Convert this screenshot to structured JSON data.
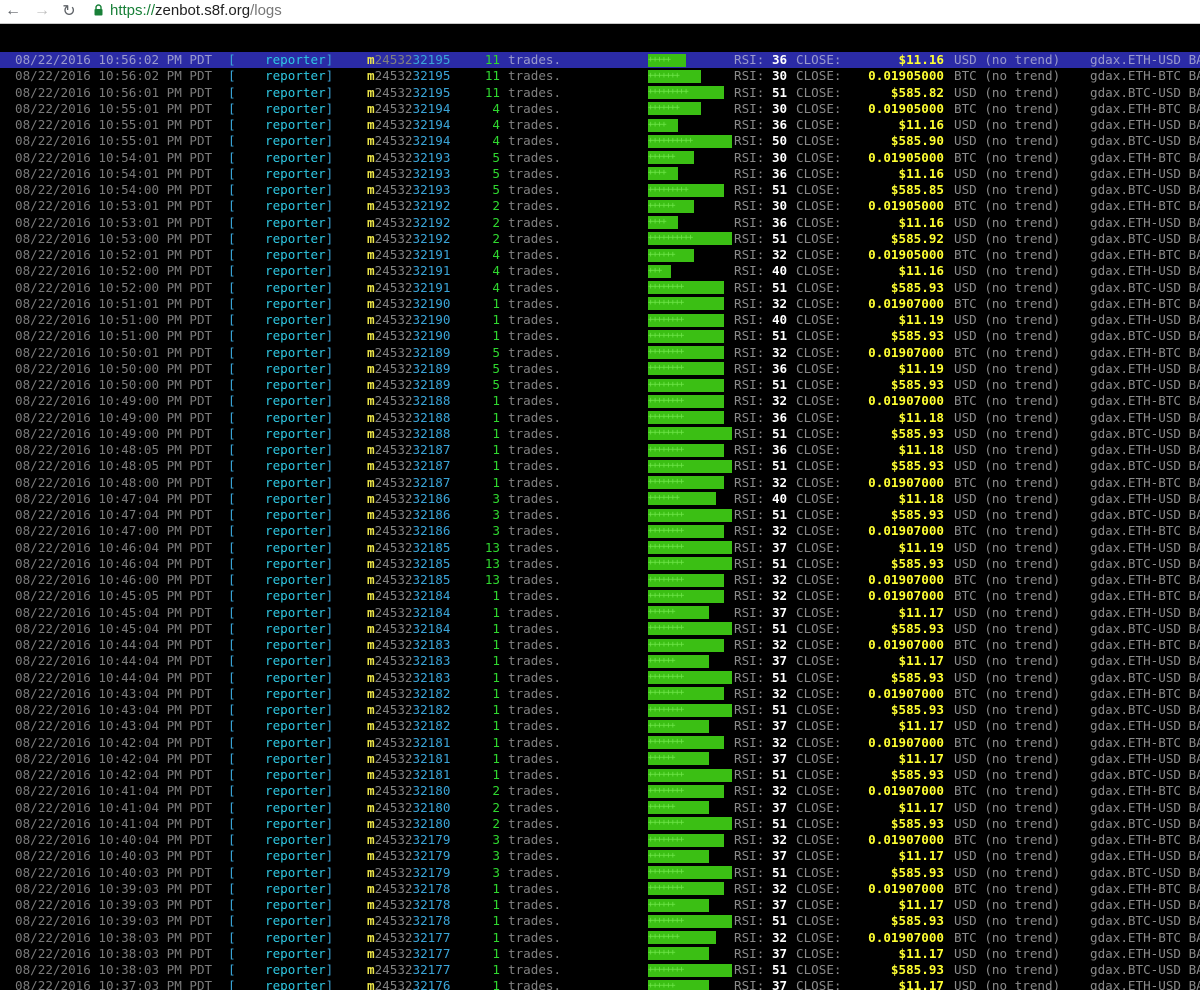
{
  "browser": {
    "url_scheme": "https://",
    "url_host": "zenbot.s8f.org",
    "url_path": "/logs",
    "back_icon": "arrow-left-icon",
    "forward_icon": "arrow-right-icon",
    "reload_icon": "reload-icon",
    "lock_icon": "lock-icon"
  },
  "colors": {
    "bar": "#3bbf14",
    "highlight": "#2b2ba6",
    "price": "#ffff32"
  },
  "log_columns": {
    "reporter": "reporter",
    "trades_suffix": "trades.",
    "rsi_label": "RSI:",
    "close_label": "CLOSE:",
    "bracket_open": "[",
    "bracket_close": "]",
    "id_prefix": "m",
    "id_middle": "24532"
  },
  "logs": [
    {
      "ts": "08/22/2016 10:56:02 PM PDT",
      "id": "95",
      "count": 11,
      "bar": "+++++",
      "barw": 5,
      "rsi": 36,
      "price": "$11.16",
      "cur": "USD (no trend)",
      "mkt": "gdax.ETH-USD BAL:",
      "hl": true
    },
    {
      "ts": "08/22/2016 10:56:02 PM PDT",
      "id": "95",
      "count": 11,
      "bar": "+++++++",
      "barw": 7,
      "rsi": 30,
      "price": "0.01905000",
      "cur": "BTC (no trend)",
      "mkt": "gdax.ETH-BTC BAL:"
    },
    {
      "ts": "08/22/2016 10:56:01 PM PDT",
      "id": "95",
      "count": 11,
      "bar": "+++++++++",
      "barw": 10,
      "rsi": 51,
      "price": "$585.82",
      "cur": "USD (no trend)",
      "mkt": "gdax.BTC-USD BAL:"
    },
    {
      "ts": "08/22/2016 10:55:01 PM PDT",
      "id": "94",
      "count": 4,
      "bar": "+++++++",
      "barw": 7,
      "rsi": 30,
      "price": "0.01905000",
      "cur": "BTC (no trend)",
      "mkt": "gdax.ETH-BTC BAL:"
    },
    {
      "ts": "08/22/2016 10:55:01 PM PDT",
      "id": "94",
      "count": 4,
      "bar": "++++",
      "barw": 4,
      "rsi": 36,
      "price": "$11.16",
      "cur": "USD (no trend)",
      "mkt": "gdax.ETH-USD BAL:"
    },
    {
      "ts": "08/22/2016 10:55:01 PM PDT",
      "id": "94",
      "count": 4,
      "bar": "++++++++++",
      "barw": 11,
      "rsi": 50,
      "price": "$585.90",
      "cur": "USD (no trend)",
      "mkt": "gdax.BTC-USD BAL:"
    },
    {
      "ts": "08/22/2016 10:54:01 PM PDT",
      "id": "93",
      "count": 5,
      "bar": "++++++",
      "barw": 6,
      "rsi": 30,
      "price": "0.01905000",
      "cur": "BTC (no trend)",
      "mkt": "gdax.ETH-BTC BAL:"
    },
    {
      "ts": "08/22/2016 10:54:01 PM PDT",
      "id": "93",
      "count": 5,
      "bar": "++++",
      "barw": 4,
      "rsi": 36,
      "price": "$11.16",
      "cur": "USD (no trend)",
      "mkt": "gdax.ETH-USD BAL:"
    },
    {
      "ts": "08/22/2016 10:54:00 PM PDT",
      "id": "93",
      "count": 5,
      "bar": "+++++++++",
      "barw": 10,
      "rsi": 51,
      "price": "$585.85",
      "cur": "USD (no trend)",
      "mkt": "gdax.BTC-USD BAL:"
    },
    {
      "ts": "08/22/2016 10:53:01 PM PDT",
      "id": "92",
      "count": 2,
      "bar": "++++++",
      "barw": 6,
      "rsi": 30,
      "price": "0.01905000",
      "cur": "BTC (no trend)",
      "mkt": "gdax.ETH-BTC BAL:"
    },
    {
      "ts": "08/22/2016 10:53:01 PM PDT",
      "id": "92",
      "count": 2,
      "bar": "++++",
      "barw": 4,
      "rsi": 36,
      "price": "$11.16",
      "cur": "USD (no trend)",
      "mkt": "gdax.ETH-USD BAL:"
    },
    {
      "ts": "08/22/2016 10:53:00 PM PDT",
      "id": "92",
      "count": 2,
      "bar": "++++++++++",
      "barw": 11,
      "rsi": 51,
      "price": "$585.92",
      "cur": "USD (no trend)",
      "mkt": "gdax.BTC-USD BAL:"
    },
    {
      "ts": "08/22/2016 10:52:01 PM PDT",
      "id": "91",
      "count": 4,
      "bar": "++++++",
      "barw": 6,
      "rsi": 32,
      "price": "0.01905000",
      "cur": "BTC (no trend)",
      "mkt": "gdax.ETH-BTC BAL:"
    },
    {
      "ts": "08/22/2016 10:52:00 PM PDT",
      "id": "91",
      "count": 4,
      "bar": "+++",
      "barw": 3,
      "rsi": 40,
      "price": "$11.16",
      "cur": "USD (no trend)",
      "mkt": "gdax.ETH-USD BAL:"
    },
    {
      "ts": "08/22/2016 10:52:00 PM PDT",
      "id": "91",
      "count": 4,
      "bar": "++++++++",
      "barw": 10,
      "rsi": 51,
      "price": "$585.93",
      "cur": "USD (no trend)",
      "mkt": "gdax.BTC-USD BAL:"
    },
    {
      "ts": "08/22/2016 10:51:01 PM PDT",
      "id": "90",
      "count": 1,
      "bar": "++++++++",
      "barw": 10,
      "rsi": 32,
      "price": "0.01907000",
      "cur": "BTC (no trend)",
      "mkt": "gdax.ETH-BTC BAL:"
    },
    {
      "ts": "08/22/2016 10:51:00 PM PDT",
      "id": "90",
      "count": 1,
      "bar": "++++++++",
      "barw": 10,
      "rsi": 40,
      "price": "$11.19",
      "cur": "USD (no trend)",
      "mkt": "gdax.ETH-USD BAL:"
    },
    {
      "ts": "08/22/2016 10:51:00 PM PDT",
      "id": "90",
      "count": 1,
      "bar": "++++++++",
      "barw": 10,
      "rsi": 51,
      "price": "$585.93",
      "cur": "USD (no trend)",
      "mkt": "gdax.BTC-USD BAL:"
    },
    {
      "ts": "08/22/2016 10:50:01 PM PDT",
      "id": "89",
      "count": 5,
      "bar": "++++++++",
      "barw": 10,
      "rsi": 32,
      "price": "0.01907000",
      "cur": "BTC (no trend)",
      "mkt": "gdax.ETH-BTC BAL:"
    },
    {
      "ts": "08/22/2016 10:50:00 PM PDT",
      "id": "89",
      "count": 5,
      "bar": "++++++++",
      "barw": 10,
      "rsi": 36,
      "price": "$11.19",
      "cur": "USD (no trend)",
      "mkt": "gdax.ETH-USD BAL:"
    },
    {
      "ts": "08/22/2016 10:50:00 PM PDT",
      "id": "89",
      "count": 5,
      "bar": "++++++++",
      "barw": 10,
      "rsi": 51,
      "price": "$585.93",
      "cur": "USD (no trend)",
      "mkt": "gdax.BTC-USD BAL:"
    },
    {
      "ts": "08/22/2016 10:49:00 PM PDT",
      "id": "88",
      "count": 1,
      "bar": "++++++++",
      "barw": 10,
      "rsi": 32,
      "price": "0.01907000",
      "cur": "BTC (no trend)",
      "mkt": "gdax.ETH-BTC BAL:"
    },
    {
      "ts": "08/22/2016 10:49:00 PM PDT",
      "id": "88",
      "count": 1,
      "bar": "++++++++",
      "barw": 10,
      "rsi": 36,
      "price": "$11.18",
      "cur": "USD (no trend)",
      "mkt": "gdax.ETH-USD BAL:"
    },
    {
      "ts": "08/22/2016 10:49:00 PM PDT",
      "id": "88",
      "count": 1,
      "bar": "++++++++",
      "barw": 11,
      "rsi": 51,
      "price": "$585.93",
      "cur": "USD (no trend)",
      "mkt": "gdax.BTC-USD BAL:"
    },
    {
      "ts": "08/22/2016 10:48:05 PM PDT",
      "id": "87",
      "count": 1,
      "bar": "++++++++",
      "barw": 10,
      "rsi": 36,
      "price": "$11.18",
      "cur": "USD (no trend)",
      "mkt": "gdax.ETH-USD BAL:"
    },
    {
      "ts": "08/22/2016 10:48:05 PM PDT",
      "id": "87",
      "count": 1,
      "bar": "++++++++",
      "barw": 11,
      "rsi": 51,
      "price": "$585.93",
      "cur": "USD (no trend)",
      "mkt": "gdax.BTC-USD BAL:"
    },
    {
      "ts": "08/22/2016 10:48:00 PM PDT",
      "id": "87",
      "count": 1,
      "bar": "++++++++",
      "barw": 10,
      "rsi": 32,
      "price": "0.01907000",
      "cur": "BTC (no trend)",
      "mkt": "gdax.ETH-BTC BAL:"
    },
    {
      "ts": "08/22/2016 10:47:04 PM PDT",
      "id": "86",
      "count": 3,
      "bar": "+++++++",
      "barw": 9,
      "rsi": 40,
      "price": "$11.18",
      "cur": "USD (no trend)",
      "mkt": "gdax.ETH-USD BAL:"
    },
    {
      "ts": "08/22/2016 10:47:04 PM PDT",
      "id": "86",
      "count": 3,
      "bar": "++++++++",
      "barw": 11,
      "rsi": 51,
      "price": "$585.93",
      "cur": "USD (no trend)",
      "mkt": "gdax.BTC-USD BAL:"
    },
    {
      "ts": "08/22/2016 10:47:00 PM PDT",
      "id": "86",
      "count": 3,
      "bar": "++++++++",
      "barw": 10,
      "rsi": 32,
      "price": "0.01907000",
      "cur": "BTC (no trend)",
      "mkt": "gdax.ETH-BTC BAL:"
    },
    {
      "ts": "08/22/2016 10:46:04 PM PDT",
      "id": "85",
      "count": 13,
      "bar": "++++++++",
      "barw": 11,
      "rsi": 37,
      "price": "$11.19",
      "cur": "USD (no trend)",
      "mkt": "gdax.ETH-USD BAL:"
    },
    {
      "ts": "08/22/2016 10:46:04 PM PDT",
      "id": "85",
      "count": 13,
      "bar": "++++++++",
      "barw": 11,
      "rsi": 51,
      "price": "$585.93",
      "cur": "USD (no trend)",
      "mkt": "gdax.BTC-USD BAL:"
    },
    {
      "ts": "08/22/2016 10:46:00 PM PDT",
      "id": "85",
      "count": 13,
      "bar": "++++++++",
      "barw": 10,
      "rsi": 32,
      "price": "0.01907000",
      "cur": "BTC (no trend)",
      "mkt": "gdax.ETH-BTC BAL:"
    },
    {
      "ts": "08/22/2016 10:45:05 PM PDT",
      "id": "84",
      "count": 1,
      "bar": "++++++++",
      "barw": 10,
      "rsi": 32,
      "price": "0.01907000",
      "cur": "BTC (no trend)",
      "mkt": "gdax.ETH-BTC BAL:"
    },
    {
      "ts": "08/22/2016 10:45:04 PM PDT",
      "id": "84",
      "count": 1,
      "bar": "++++++",
      "barw": 8,
      "rsi": 37,
      "price": "$11.17",
      "cur": "USD (no trend)",
      "mkt": "gdax.ETH-USD BAL:"
    },
    {
      "ts": "08/22/2016 10:45:04 PM PDT",
      "id": "84",
      "count": 1,
      "bar": "++++++++",
      "barw": 11,
      "rsi": 51,
      "price": "$585.93",
      "cur": "USD (no trend)",
      "mkt": "gdax.BTC-USD BAL:"
    },
    {
      "ts": "08/22/2016 10:44:04 PM PDT",
      "id": "83",
      "count": 1,
      "bar": "++++++++",
      "barw": 10,
      "rsi": 32,
      "price": "0.01907000",
      "cur": "BTC (no trend)",
      "mkt": "gdax.ETH-BTC BAL:"
    },
    {
      "ts": "08/22/2016 10:44:04 PM PDT",
      "id": "83",
      "count": 1,
      "bar": "++++++",
      "barw": 8,
      "rsi": 37,
      "price": "$11.17",
      "cur": "USD (no trend)",
      "mkt": "gdax.ETH-USD BAL:"
    },
    {
      "ts": "08/22/2016 10:44:04 PM PDT",
      "id": "83",
      "count": 1,
      "bar": "++++++++",
      "barw": 11,
      "rsi": 51,
      "price": "$585.93",
      "cur": "USD (no trend)",
      "mkt": "gdax.BTC-USD BAL:"
    },
    {
      "ts": "08/22/2016 10:43:04 PM PDT",
      "id": "82",
      "count": 1,
      "bar": "++++++++",
      "barw": 10,
      "rsi": 32,
      "price": "0.01907000",
      "cur": "BTC (no trend)",
      "mkt": "gdax.ETH-BTC BAL:"
    },
    {
      "ts": "08/22/2016 10:43:04 PM PDT",
      "id": "82",
      "count": 1,
      "bar": "++++++++",
      "barw": 11,
      "rsi": 51,
      "price": "$585.93",
      "cur": "USD (no trend)",
      "mkt": "gdax.BTC-USD BAL:"
    },
    {
      "ts": "08/22/2016 10:43:04 PM PDT",
      "id": "82",
      "count": 1,
      "bar": "++++++",
      "barw": 8,
      "rsi": 37,
      "price": "$11.17",
      "cur": "USD (no trend)",
      "mkt": "gdax.ETH-USD BAL:"
    },
    {
      "ts": "08/22/2016 10:42:04 PM PDT",
      "id": "81",
      "count": 1,
      "bar": "++++++++",
      "barw": 10,
      "rsi": 32,
      "price": "0.01907000",
      "cur": "BTC (no trend)",
      "mkt": "gdax.ETH-BTC BAL:"
    },
    {
      "ts": "08/22/2016 10:42:04 PM PDT",
      "id": "81",
      "count": 1,
      "bar": "++++++",
      "barw": 8,
      "rsi": 37,
      "price": "$11.17",
      "cur": "USD (no trend)",
      "mkt": "gdax.ETH-USD BAL:"
    },
    {
      "ts": "08/22/2016 10:42:04 PM PDT",
      "id": "81",
      "count": 1,
      "bar": "++++++++",
      "barw": 11,
      "rsi": 51,
      "price": "$585.93",
      "cur": "USD (no trend)",
      "mkt": "gdax.BTC-USD BAL:"
    },
    {
      "ts": "08/22/2016 10:41:04 PM PDT",
      "id": "80",
      "count": 2,
      "bar": "++++++++",
      "barw": 10,
      "rsi": 32,
      "price": "0.01907000",
      "cur": "BTC (no trend)",
      "mkt": "gdax.ETH-BTC BAL:"
    },
    {
      "ts": "08/22/2016 10:41:04 PM PDT",
      "id": "80",
      "count": 2,
      "bar": "++++++",
      "barw": 8,
      "rsi": 37,
      "price": "$11.17",
      "cur": "USD (no trend)",
      "mkt": "gdax.ETH-USD BAL:"
    },
    {
      "ts": "08/22/2016 10:41:04 PM PDT",
      "id": "80",
      "count": 2,
      "bar": "++++++++",
      "barw": 11,
      "rsi": 51,
      "price": "$585.93",
      "cur": "USD (no trend)",
      "mkt": "gdax.BTC-USD BAL:"
    },
    {
      "ts": "08/22/2016 10:40:04 PM PDT",
      "id": "79",
      "count": 3,
      "bar": "++++++++",
      "barw": 10,
      "rsi": 32,
      "price": "0.01907000",
      "cur": "BTC (no trend)",
      "mkt": "gdax.ETH-BTC BAL:"
    },
    {
      "ts": "08/22/2016 10:40:03 PM PDT",
      "id": "79",
      "count": 3,
      "bar": "++++++",
      "barw": 8,
      "rsi": 37,
      "price": "$11.17",
      "cur": "USD (no trend)",
      "mkt": "gdax.ETH-USD BAL:"
    },
    {
      "ts": "08/22/2016 10:40:03 PM PDT",
      "id": "79",
      "count": 3,
      "bar": "++++++++",
      "barw": 11,
      "rsi": 51,
      "price": "$585.93",
      "cur": "USD (no trend)",
      "mkt": "gdax.BTC-USD BAL:"
    },
    {
      "ts": "08/22/2016 10:39:03 PM PDT",
      "id": "78",
      "count": 1,
      "bar": "++++++++",
      "barw": 10,
      "rsi": 32,
      "price": "0.01907000",
      "cur": "BTC (no trend)",
      "mkt": "gdax.ETH-BTC BAL:"
    },
    {
      "ts": "08/22/2016 10:39:03 PM PDT",
      "id": "78",
      "count": 1,
      "bar": "++++++",
      "barw": 8,
      "rsi": 37,
      "price": "$11.17",
      "cur": "USD (no trend)",
      "mkt": "gdax.ETH-USD BAL:"
    },
    {
      "ts": "08/22/2016 10:39:03 PM PDT",
      "id": "78",
      "count": 1,
      "bar": "++++++++",
      "barw": 11,
      "rsi": 51,
      "price": "$585.93",
      "cur": "USD (no trend)",
      "mkt": "gdax.BTC-USD BAL:"
    },
    {
      "ts": "08/22/2016 10:38:03 PM PDT",
      "id": "77",
      "count": 1,
      "bar": "+++++++",
      "barw": 9,
      "rsi": 32,
      "price": "0.01907000",
      "cur": "BTC (no trend)",
      "mkt": "gdax.ETH-BTC BAL:"
    },
    {
      "ts": "08/22/2016 10:38:03 PM PDT",
      "id": "77",
      "count": 1,
      "bar": "++++++",
      "barw": 8,
      "rsi": 37,
      "price": "$11.17",
      "cur": "USD (no trend)",
      "mkt": "gdax.ETH-USD BAL:"
    },
    {
      "ts": "08/22/2016 10:38:03 PM PDT",
      "id": "77",
      "count": 1,
      "bar": "++++++++",
      "barw": 11,
      "rsi": 51,
      "price": "$585.93",
      "cur": "USD (no trend)",
      "mkt": "gdax.BTC-USD BAL:"
    },
    {
      "ts": "08/22/2016 10:37:03 PM PDT",
      "id": "76",
      "count": 1,
      "bar": "++++++",
      "barw": 8,
      "rsi": 37,
      "price": "$11.17",
      "cur": "USD (no trend)",
      "mkt": "gdax.ETH-USD BAL:"
    }
  ]
}
